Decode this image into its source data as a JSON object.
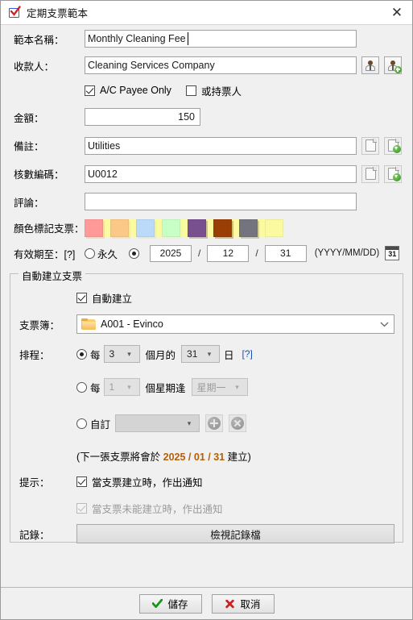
{
  "window": {
    "title": "定期支票範本",
    "icon": "check-template-icon",
    "close_label": "✕"
  },
  "form": {
    "template_name": {
      "label": "範本名稱：",
      "value": "Monthly Cleaning Fee"
    },
    "payee": {
      "label": "收款人：",
      "value": "Cleaning Services Company",
      "select_icon": "person-icon",
      "add_icon": "person-add-icon"
    },
    "ac_payee_only": {
      "label": "A/C Payee Only",
      "checked": true
    },
    "or_bearer": {
      "label": "或持票人",
      "checked": false
    },
    "amount": {
      "label": "金額：",
      "value": "150"
    },
    "memo": {
      "label": "備註：",
      "value": "Utilities",
      "clear_icon": "page-icon",
      "save_icon": "page-add-icon"
    },
    "audit_code": {
      "label": "核數編碼：",
      "value": "U0012",
      "clear_icon": "page-icon",
      "save_icon": "page-add-icon"
    },
    "comment": {
      "label": "評論：",
      "value": ""
    },
    "color_mark": {
      "label": "顏色標記支票：",
      "swatches": [
        {
          "name": "yellow",
          "hex": "#FBFAA0"
        },
        {
          "name": "salmon",
          "hex": "#FF9A98"
        },
        {
          "name": "orange",
          "hex": "#FCC887"
        },
        {
          "name": "blue",
          "hex": "#BBD9F9"
        },
        {
          "name": "green",
          "hex": "#C7FFC7"
        },
        {
          "name": "purple",
          "hex": "#784F8F"
        },
        {
          "name": "brown",
          "hex": "#993F06"
        },
        {
          "name": "gray",
          "hex": "#74747E"
        }
      ]
    },
    "valid_until": {
      "label": "有效期至：[?]",
      "forever_label": "永久",
      "forever_selected": false,
      "date_selected": true,
      "year": "2025",
      "month": "12",
      "day": "31",
      "separator": "/",
      "format_hint": "(YYYY/MM/DD)",
      "calendar_icon": "calendar-icon",
      "calendar_day": "31"
    }
  },
  "auto_create": {
    "group_title": "自動建立支票",
    "auto_create_checkbox": {
      "label": "自動建立",
      "checked": true
    },
    "cheque_book": {
      "label": "支票簿：",
      "value": "A001 - Evinco",
      "folder_icon": "folder-icon",
      "dropdown_icon": "chevron-down-icon"
    },
    "schedule": {
      "label": "排程：",
      "monthly": {
        "selected": true,
        "every_label": "每",
        "count": "3",
        "unit_label": "個月的",
        "day": "31",
        "day_label": "日",
        "help": "[?]"
      },
      "weekly": {
        "selected": false,
        "every_label": "每",
        "count": "1",
        "unit_label": "個星期逢",
        "weekday": "星期一"
      },
      "custom": {
        "selected": false,
        "label": "自訂",
        "value": "",
        "add_icon": "circle-plus-icon",
        "remove_icon": "circle-x-icon"
      }
    },
    "next_note": {
      "prefix": "(下一張支票將會於 ",
      "date": "2025 / 01 / 31",
      "suffix": " 建立)"
    },
    "notify": {
      "label": "提示：",
      "on_create": {
        "label": "當支票建立時，作出通知",
        "checked": true,
        "enabled": true
      },
      "on_fail": {
        "label": "當支票未能建立時，作出通知",
        "checked": true,
        "enabled": false
      }
    },
    "log": {
      "label": "記錄：",
      "button_label": "檢視記錄檔"
    }
  },
  "footer": {
    "save": {
      "label": "儲存",
      "icon": "green-check-icon"
    },
    "cancel": {
      "label": "取消",
      "icon": "red-x-icon"
    }
  }
}
